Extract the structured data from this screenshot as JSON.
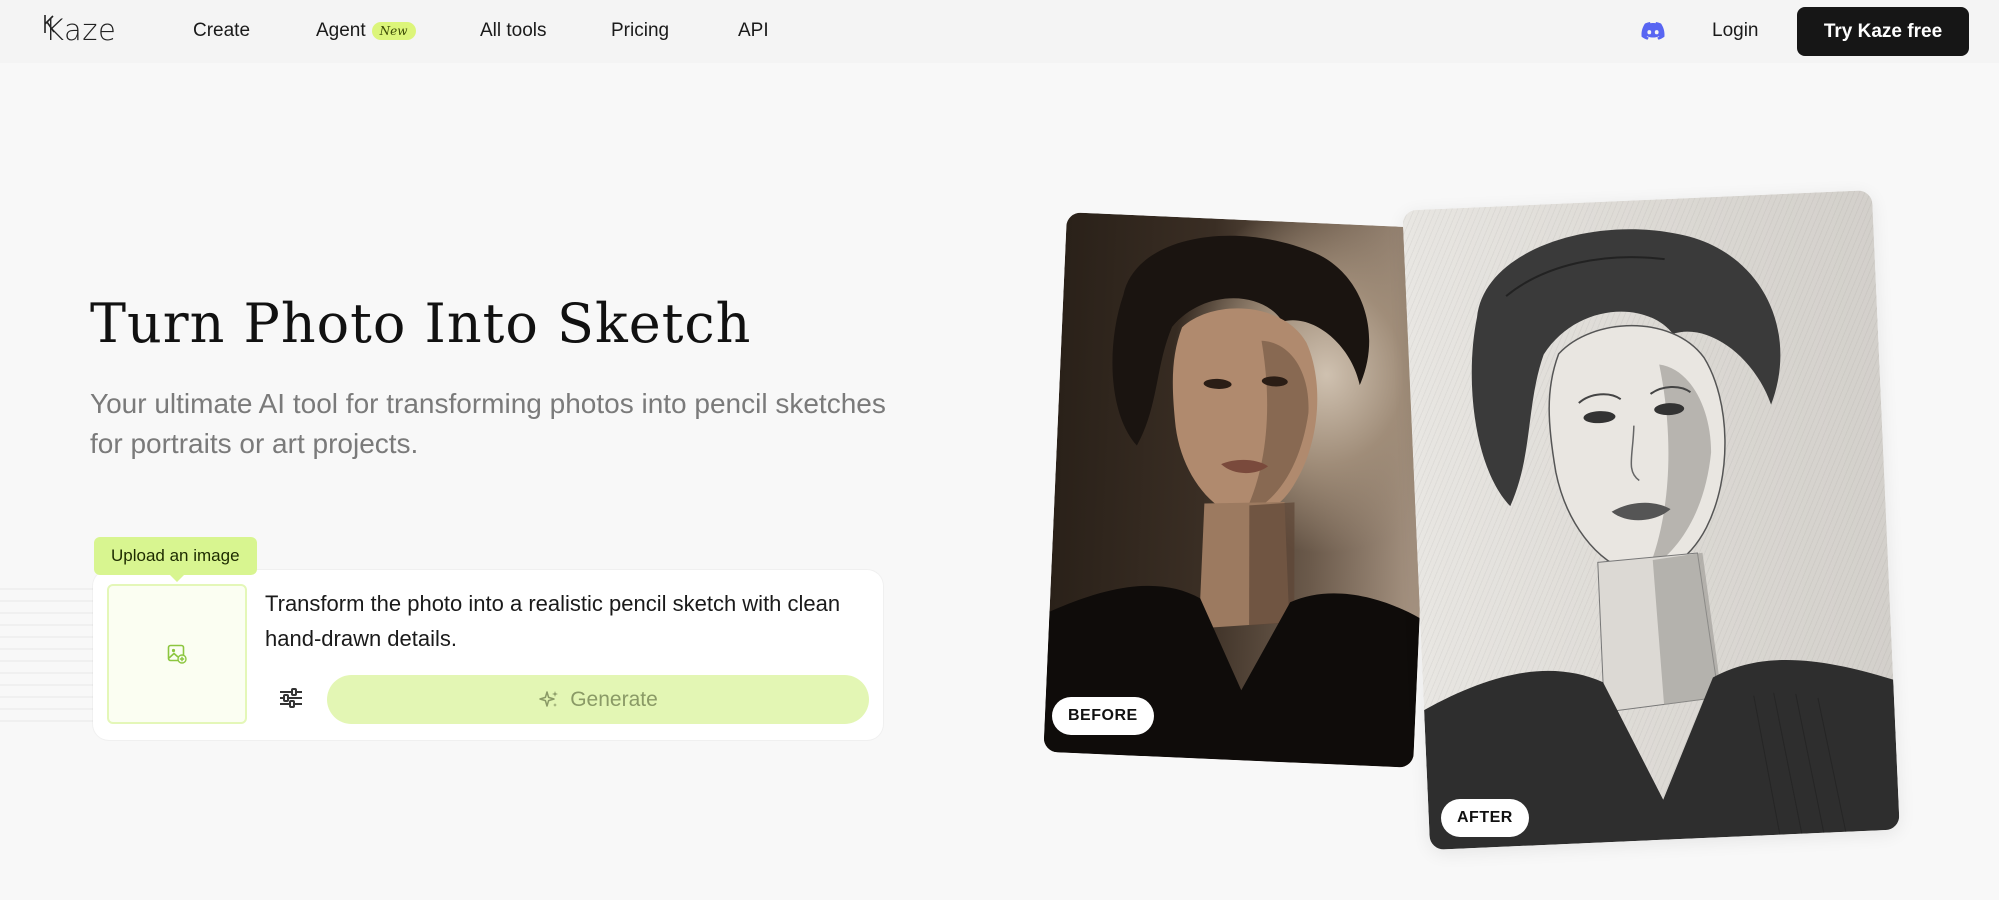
{
  "header": {
    "logo_text": "Kaze",
    "nav": [
      {
        "label": "Create"
      },
      {
        "label": "Agent",
        "badge": "New"
      },
      {
        "label": "All tools"
      },
      {
        "label": "Pricing"
      },
      {
        "label": "API"
      }
    ],
    "discord_icon": "discord-icon",
    "login_label": "Login",
    "cta_label": "Try Kaze free"
  },
  "hero": {
    "title": "Turn Photo Into Sketch",
    "subtitle": "Your ultimate AI tool for transforming photos into pencil sketches for portraits or art projects."
  },
  "prompt_card": {
    "upload_tooltip": "Upload an image",
    "upload_icon": "image-add-icon",
    "prompt_text": "Transform the photo into a realistic pencil sketch with clean hand-drawn details.",
    "settings_icon": "sliders-icon",
    "generate_icon": "sparkle-icon",
    "generate_label": "Generate"
  },
  "comparison": {
    "before_label": "BEFORE",
    "after_label": "AFTER"
  },
  "colors": {
    "accent": "#d8f590",
    "cta_bg": "#161616",
    "discord": "#5865f2"
  }
}
